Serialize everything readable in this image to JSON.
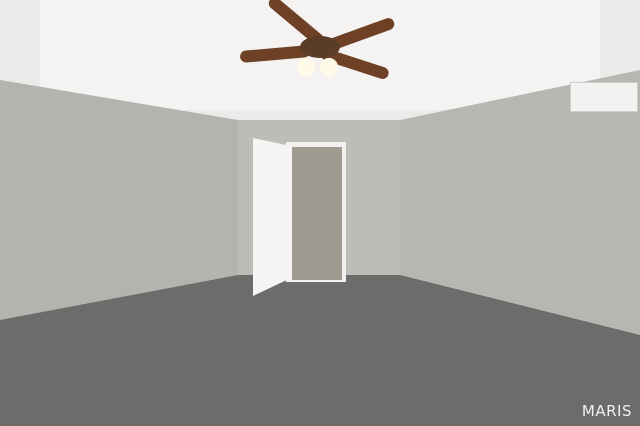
{
  "watermark": {
    "text": "MARIS"
  }
}
